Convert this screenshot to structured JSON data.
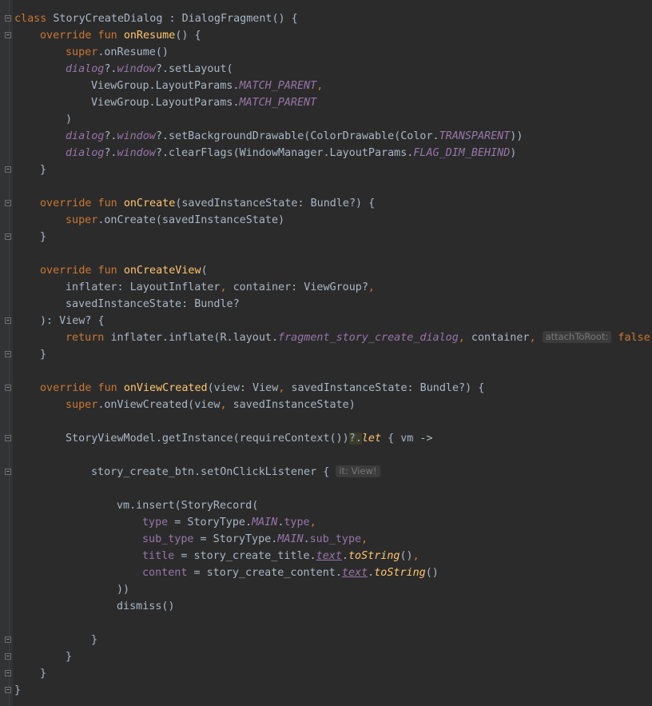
{
  "editor": {
    "language": "kotlin",
    "colors": {
      "background": "#2b2b2b",
      "gutter": "#313335",
      "text": "#a9b7c6",
      "keyword": "#cc7832",
      "function": "#ffc66d",
      "property": "#9876aa",
      "hint_text": "#787878",
      "hint_background": "#3b3b3b",
      "highlight": "#3b3b2a"
    },
    "lines": [
      {
        "indent": 0,
        "fold": "start",
        "segs": [
          {
            "t": "class",
            "c": "kw"
          },
          {
            "t": " StoryCreateDialog : DialogFragment() {"
          }
        ]
      },
      {
        "indent": 1,
        "fold": "start",
        "segs": [
          {
            "t": "override fun ",
            "c": "kw"
          },
          {
            "t": "onResume",
            "c": "fn"
          },
          {
            "t": "() {"
          }
        ]
      },
      {
        "indent": 2,
        "segs": [
          {
            "t": "super",
            "c": "kw"
          },
          {
            "t": ".onResume()"
          }
        ]
      },
      {
        "indent": 2,
        "segs": [
          {
            "t": "dialog",
            "c": "prop ital"
          },
          {
            "t": "?."
          },
          {
            "t": "window",
            "c": "prop ital"
          },
          {
            "t": "?.setLayout("
          }
        ]
      },
      {
        "indent": 3,
        "segs": [
          {
            "t": "ViewGroup.LayoutParams."
          },
          {
            "t": "MATCH_PARENT",
            "c": "prop ital"
          },
          {
            "t": ",",
            "c": "kw"
          }
        ]
      },
      {
        "indent": 3,
        "segs": [
          {
            "t": "ViewGroup.LayoutParams."
          },
          {
            "t": "MATCH_PARENT",
            "c": "prop ital"
          }
        ]
      },
      {
        "indent": 2,
        "segs": [
          {
            "t": ")"
          }
        ]
      },
      {
        "indent": 2,
        "segs": [
          {
            "t": "dialog",
            "c": "prop ital"
          },
          {
            "t": "?."
          },
          {
            "t": "window",
            "c": "prop ital"
          },
          {
            "t": "?.setBackgroundDrawable(ColorDrawable(Color."
          },
          {
            "t": "TRANSPARENT",
            "c": "prop ital"
          },
          {
            "t": "))"
          }
        ]
      },
      {
        "indent": 2,
        "segs": [
          {
            "t": "dialog",
            "c": "prop ital"
          },
          {
            "t": "?."
          },
          {
            "t": "window",
            "c": "prop ital"
          },
          {
            "t": "?.clearFlags(WindowManager.LayoutParams."
          },
          {
            "t": "FLAG_DIM_BEHIND",
            "c": "prop ital"
          },
          {
            "t": ")"
          }
        ]
      },
      {
        "indent": 1,
        "fold": "end",
        "segs": [
          {
            "t": "}"
          }
        ]
      },
      {
        "indent": 0,
        "segs": []
      },
      {
        "indent": 1,
        "fold": "start",
        "segs": [
          {
            "t": "override fun ",
            "c": "kw"
          },
          {
            "t": "onCreate",
            "c": "fn"
          },
          {
            "t": "(savedInstanceState: Bundle?) {"
          }
        ]
      },
      {
        "indent": 2,
        "segs": [
          {
            "t": "super",
            "c": "kw"
          },
          {
            "t": ".onCreate(savedInstanceState)"
          }
        ]
      },
      {
        "indent": 1,
        "fold": "end",
        "segs": [
          {
            "t": "}"
          }
        ]
      },
      {
        "indent": 0,
        "segs": []
      },
      {
        "indent": 1,
        "segs": [
          {
            "t": "override fun ",
            "c": "kw"
          },
          {
            "t": "onCreateView",
            "c": "fn"
          },
          {
            "t": "("
          }
        ]
      },
      {
        "indent": 2,
        "segs": [
          {
            "t": "inflater: LayoutInflater"
          },
          {
            "t": ",",
            "c": "kw"
          },
          {
            "t": " container: ViewGroup?"
          },
          {
            "t": ",",
            "c": "kw"
          }
        ]
      },
      {
        "indent": 2,
        "segs": [
          {
            "t": "savedInstanceState: Bundle?"
          }
        ]
      },
      {
        "indent": 1,
        "fold": "start",
        "segs": [
          {
            "t": "): View? {"
          }
        ]
      },
      {
        "indent": 2,
        "segs": [
          {
            "t": "return ",
            "c": "kw"
          },
          {
            "t": "inflater.inflate(R.layout."
          },
          {
            "t": "fragment_story_create_dialog",
            "c": "prop ital"
          },
          {
            "t": ",",
            "c": "kw"
          },
          {
            "t": " container"
          },
          {
            "t": ",",
            "c": "kw"
          },
          {
            "t": " "
          },
          {
            "t": "attachToRoot:",
            "c": "hint"
          },
          {
            "t": " "
          },
          {
            "t": "false",
            "c": "kw"
          },
          {
            "t": ")"
          }
        ]
      },
      {
        "indent": 1,
        "fold": "end",
        "segs": [
          {
            "t": "}"
          }
        ]
      },
      {
        "indent": 0,
        "segs": []
      },
      {
        "indent": 1,
        "fold": "start",
        "segs": [
          {
            "t": "override fun ",
            "c": "kw"
          },
          {
            "t": "onViewCreated",
            "c": "fn"
          },
          {
            "t": "(view: View"
          },
          {
            "t": ",",
            "c": "kw"
          },
          {
            "t": " savedInstanceState: Bundle?) {"
          }
        ]
      },
      {
        "indent": 2,
        "segs": [
          {
            "t": "super",
            "c": "kw"
          },
          {
            "t": ".onViewCreated(view"
          },
          {
            "t": ",",
            "c": "kw"
          },
          {
            "t": " savedInstanceState)"
          }
        ]
      },
      {
        "indent": 0,
        "segs": []
      },
      {
        "indent": 2,
        "fold": "start",
        "segs": [
          {
            "t": "StoryViewModel.getInstance(requireContext())"
          },
          {
            "t": "?.",
            "c": "hl"
          },
          {
            "t": "let",
            "c": "fn ital"
          },
          {
            "t": " { vm ->"
          }
        ]
      },
      {
        "indent": 0,
        "segs": []
      },
      {
        "indent": 3,
        "fold": "start",
        "segs": [
          {
            "t": "story_create_btn.setOnClickListener { "
          },
          {
            "t": "it: View!",
            "c": "hint"
          }
        ]
      },
      {
        "indent": 0,
        "segs": []
      },
      {
        "indent": 4,
        "segs": [
          {
            "t": "vm.insert(StoryRecord("
          }
        ]
      },
      {
        "indent": 5,
        "segs": [
          {
            "t": "type",
            "c": "prop"
          },
          {
            "t": " = StoryType."
          },
          {
            "t": "MAIN",
            "c": "prop ital"
          },
          {
            "t": "."
          },
          {
            "t": "type",
            "c": "prop"
          },
          {
            "t": ",",
            "c": "kw"
          }
        ]
      },
      {
        "indent": 5,
        "segs": [
          {
            "t": "sub_type",
            "c": "prop"
          },
          {
            "t": " = StoryType."
          },
          {
            "t": "MAIN",
            "c": "prop ital"
          },
          {
            "t": "."
          },
          {
            "t": "sub_type",
            "c": "prop"
          },
          {
            "t": ",",
            "c": "kw"
          }
        ]
      },
      {
        "indent": 5,
        "segs": [
          {
            "t": "title",
            "c": "prop"
          },
          {
            "t": " = story_create_title."
          },
          {
            "t": "text",
            "c": "prop ital ul"
          },
          {
            "t": "."
          },
          {
            "t": "toString",
            "c": "fn ital"
          },
          {
            "t": "()"
          },
          {
            "t": ",",
            "c": "kw"
          }
        ]
      },
      {
        "indent": 5,
        "segs": [
          {
            "t": "content",
            "c": "prop"
          },
          {
            "t": " = story_create_content."
          },
          {
            "t": "text",
            "c": "prop ital ul"
          },
          {
            "t": "."
          },
          {
            "t": "toString",
            "c": "fn ital"
          },
          {
            "t": "()"
          }
        ]
      },
      {
        "indent": 4,
        "segs": [
          {
            "t": "))"
          }
        ]
      },
      {
        "indent": 4,
        "segs": [
          {
            "t": "dismiss()"
          }
        ]
      },
      {
        "indent": 0,
        "segs": []
      },
      {
        "indent": 3,
        "fold": "end",
        "segs": [
          {
            "t": "}"
          }
        ]
      },
      {
        "indent": 2,
        "fold": "end",
        "segs": [
          {
            "t": "}"
          }
        ]
      },
      {
        "indent": 1,
        "fold": "end",
        "segs": [
          {
            "t": "}"
          }
        ]
      },
      {
        "indent": 0,
        "fold": "end",
        "segs": [
          {
            "t": "}"
          }
        ]
      }
    ]
  }
}
